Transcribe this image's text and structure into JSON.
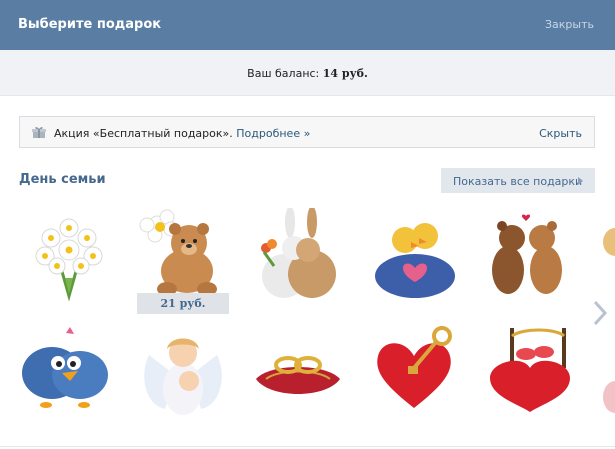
{
  "header": {
    "title": "Выберите подарок",
    "close_label": "Закрыть"
  },
  "balance": {
    "label": "Ваш баланс:",
    "amount": "14 руб."
  },
  "promo": {
    "icon": "gift-icon",
    "text": "Акция «Бесплатный подарок».",
    "more_label": "Подробнее »",
    "hide_label": "Скрыть"
  },
  "section": {
    "title": "День семьи",
    "show_all_label": "Показать все подарки"
  },
  "gifts": {
    "row1": [
      "daisy-bouquet",
      "teddy-bear-with-daisy",
      "bunnies-with-flowers",
      "ducks-in-sweater",
      "kissing-bears",
      "partial-gift"
    ],
    "row2": [
      "blue-birds",
      "angel-mother-child",
      "wedding-rings-pillow",
      "heart-lock-key",
      "red-heart-bed",
      "partial-gift"
    ],
    "hover_price": "21 руб."
  },
  "colors": {
    "header_bg": "#597da3",
    "accent": "#45688e",
    "link": "#2b587a"
  }
}
